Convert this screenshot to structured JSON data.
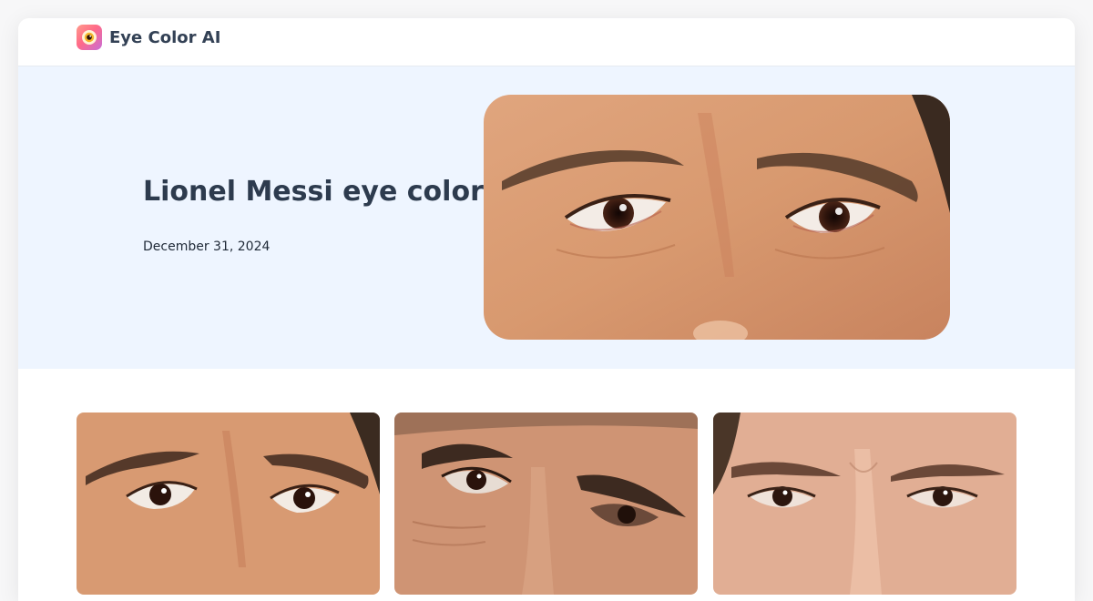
{
  "header": {
    "brand_name": "Eye Color AI",
    "logo_icon": "eye-logo-icon"
  },
  "hero": {
    "title": "Lionel Messi eye color",
    "date": "December 31, 2024",
    "background_color": "#eef5ff",
    "image": "eyes-closeup-photo"
  },
  "gallery": {
    "items": [
      {
        "image": "eyes-closeup-photo-1"
      },
      {
        "image": "eyes-closeup-photo-2"
      },
      {
        "image": "eyes-closeup-photo-3"
      }
    ]
  },
  "colors": {
    "brand_text": "#334155",
    "title_text": "#2d3b4e",
    "eye_iris": "#3b1d14"
  }
}
